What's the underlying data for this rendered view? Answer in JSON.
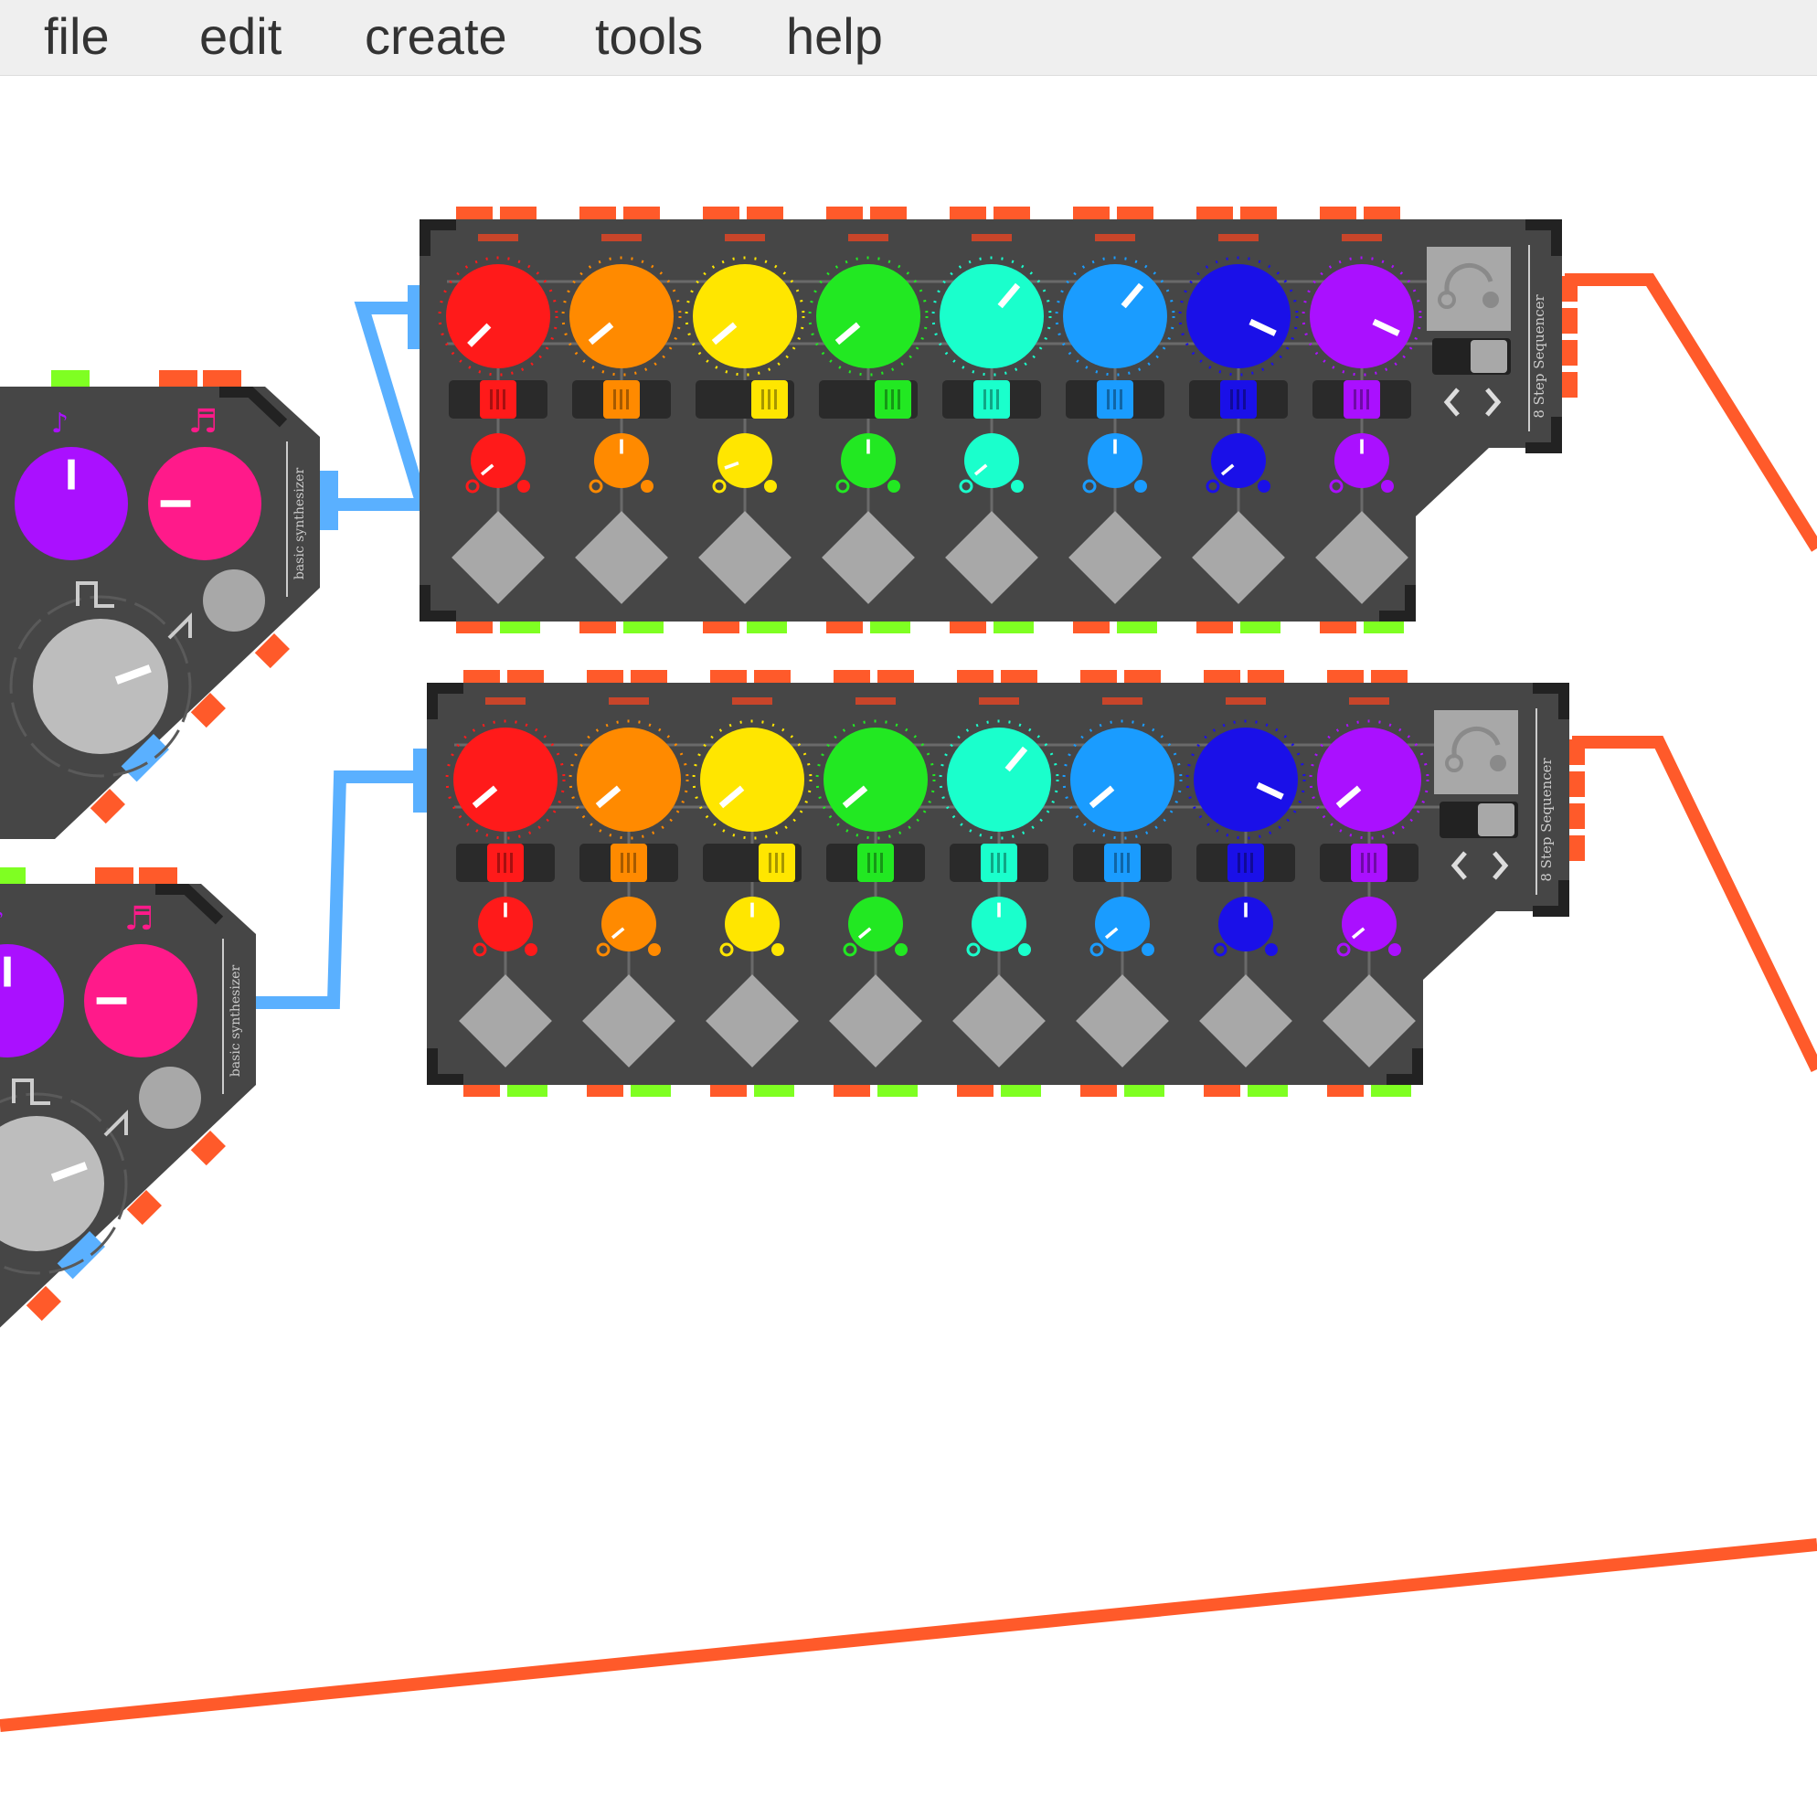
{
  "menu": {
    "items": [
      {
        "label": "file"
      },
      {
        "label": "edit"
      },
      {
        "label": "create"
      },
      {
        "label": "tools"
      },
      {
        "label": "help"
      }
    ]
  },
  "sequencers": [
    {
      "title": "8 Step Sequencer",
      "steps": [
        {
          "color": "#ff1a1a",
          "pitch_angle": -135,
          "fader": 0.5,
          "gate_angle": -130
        },
        {
          "color": "#ff8a00",
          "pitch_angle": -130,
          "fader": 0.5,
          "gate_angle": 0
        },
        {
          "color": "#ffe600",
          "pitch_angle": -130,
          "fader": 0.75,
          "gate_angle": -110
        },
        {
          "color": "#22e822",
          "pitch_angle": -130,
          "fader": 0.75,
          "gate_angle": 0
        },
        {
          "color": "#1affcc",
          "pitch_angle": 40,
          "fader": 0.5,
          "gate_angle": -130
        },
        {
          "color": "#1a9cff",
          "pitch_angle": 40,
          "fader": 0.5,
          "gate_angle": 0
        },
        {
          "color": "#1a10e8",
          "pitch_angle": 115,
          "fader": 0.5,
          "gate_angle": -130
        },
        {
          "color": "#aa10ff",
          "pitch_angle": 115,
          "fader": 0.5,
          "gate_angle": 0
        }
      ]
    },
    {
      "title": "8 Step Sequencer",
      "steps": [
        {
          "color": "#ff1a1a",
          "pitch_angle": -130,
          "fader": 0.5,
          "gate_angle": 0
        },
        {
          "color": "#ff8a00",
          "pitch_angle": -130,
          "fader": 0.5,
          "gate_angle": -130
        },
        {
          "color": "#ffe600",
          "pitch_angle": -130,
          "fader": 0.75,
          "gate_angle": 0
        },
        {
          "color": "#22e822",
          "pitch_angle": -130,
          "fader": 0.5,
          "gate_angle": -130
        },
        {
          "color": "#1affcc",
          "pitch_angle": 40,
          "fader": 0.5,
          "gate_angle": 0
        },
        {
          "color": "#1a9cff",
          "pitch_angle": -130,
          "fader": 0.5,
          "gate_angle": -130
        },
        {
          "color": "#1a10e8",
          "pitch_angle": 115,
          "fader": 0.5,
          "gate_angle": 0
        },
        {
          "color": "#aa10ff",
          "pitch_angle": -130,
          "fader": 0.5,
          "gate_angle": -130
        }
      ]
    }
  ],
  "synths": [
    {
      "title": "basic synthesizer",
      "osc_angle": 0,
      "filter_angle": -90,
      "wave_angle": 70
    },
    {
      "title": "basic synthesizer",
      "osc_angle": 0,
      "filter_angle": -90,
      "wave_angle": 70
    }
  ],
  "colors": {
    "cable_output": "#ff5a2a",
    "cable_input": "#5ab0ff",
    "port_green": "#7fff22",
    "panel": "#464646",
    "panel_dark": "#222222"
  }
}
